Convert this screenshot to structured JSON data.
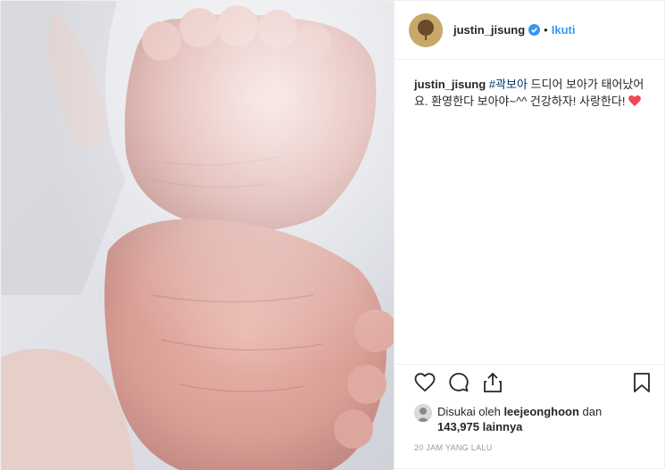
{
  "post": {
    "username": "justin_jisung",
    "follow_label": "Ikuti",
    "separator": "•",
    "caption": {
      "username": "justin_jisung",
      "hashtag": "#곽보아",
      "text": " 드디어 보아가 태어났어요. 환영한다 보아야~^^ 건강하자! 사랑한다! ",
      "emoji": "heart"
    },
    "likes": {
      "prefix": "Disukai oleh ",
      "liker": "leejeonghoon",
      "mid": " dan",
      "count": "143,975",
      "suffix": " lainnya"
    },
    "timestamp": "20 JAM YANG LALU"
  },
  "icons": {
    "like": "heart-outline-icon",
    "comment": "comment-bubble-icon",
    "share": "share-icon",
    "save": "bookmark-icon",
    "verified": "verified-badge-icon"
  },
  "colors": {
    "accent": "#3897f0",
    "text": "#262626",
    "muted": "#999999",
    "heart": "#ed4956"
  }
}
